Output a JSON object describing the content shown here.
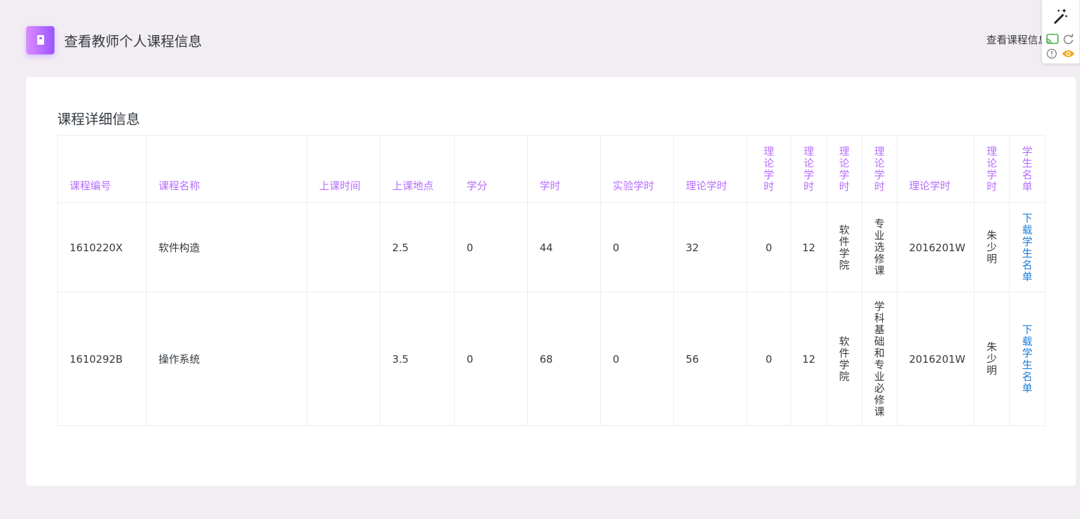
{
  "header": {
    "title": "查看教师个人课程信息",
    "breadcrumb": "查看课程信息"
  },
  "card": {
    "title": "课程详细信息"
  },
  "table": {
    "columns": [
      "课程编号",
      "课程名称",
      "上课时间",
      "上课地点",
      "学分",
      "学时",
      "实验学时",
      "理论学时",
      "理论学时",
      "理论学时",
      "理论学时",
      "理论学时",
      "理论学时",
      "理论学时",
      "学生名单"
    ],
    "rows": [
      {
        "cells": [
          "1610220X",
          "软件构造",
          "",
          "2.5",
          "0",
          "44",
          "0",
          "32",
          "0",
          "12",
          "软件学院",
          "专业选修课",
          "2016201W",
          "朱少明"
        ],
        "link": "下载学生名单"
      },
      {
        "cells": [
          "1610292B",
          "操作系统",
          "",
          "3.5",
          "0",
          "68",
          "0",
          "56",
          "0",
          "12",
          "软件学院",
          "学科基础和专业必修课",
          "2016201W",
          "朱少明"
        ],
        "link": "下载学生名单"
      }
    ]
  },
  "colors": {
    "background": "#f2edf3",
    "header_accent": "#b66dff",
    "link": "#1c7ddb",
    "icon_gradient_start": "#da8cff",
    "icon_gradient_end": "#9a55ff"
  },
  "icons": {
    "page_icon": "book-icon",
    "extension_icons": [
      "magic-wand-icon",
      "cast-icon",
      "reload-icon",
      "info-icon",
      "eye-icon"
    ]
  }
}
